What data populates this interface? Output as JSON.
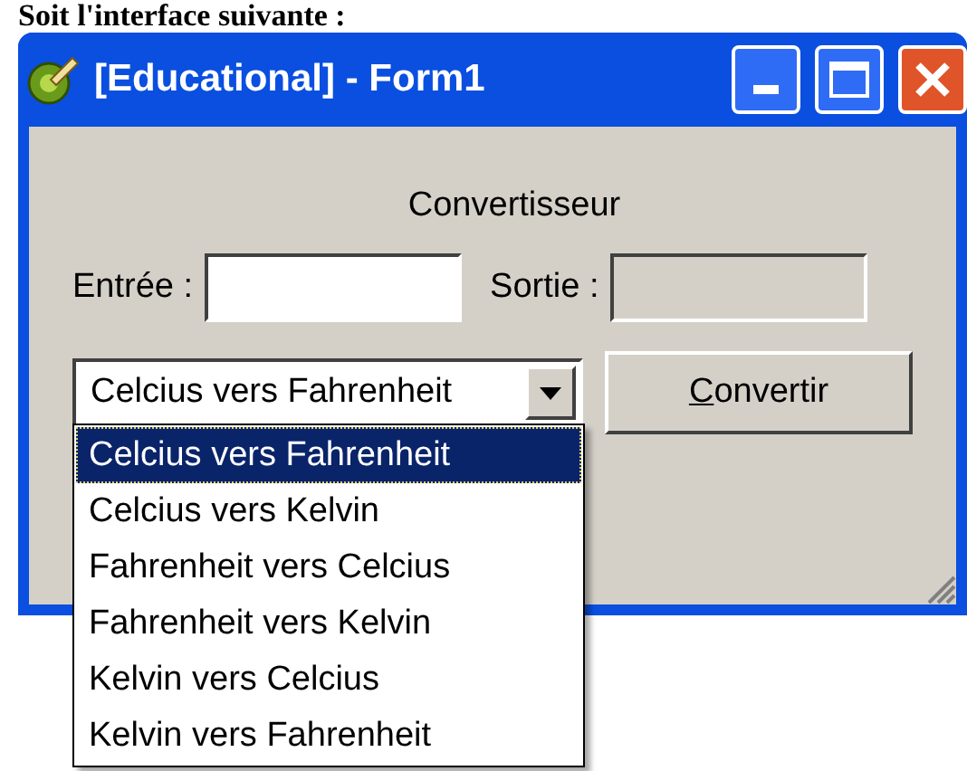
{
  "document": {
    "heading": "Soit l'interface suivante :"
  },
  "window": {
    "title": "[Educational] - Form1",
    "active": true
  },
  "form": {
    "caption": "Convertisseur",
    "input": {
      "label": "Entrée :",
      "disabled": false
    },
    "output": {
      "label": "Sortie :",
      "disabled": true
    },
    "combo": {
      "value": "Celcius vers Fahrenheit",
      "expanded": true,
      "options": [
        {
          "label": "Celcius vers Fahrenheit",
          "selected": true
        },
        {
          "label": "Celcius vers Kelvin",
          "selected": false
        },
        {
          "label": "Fahrenheit vers Celcius",
          "selected": false
        },
        {
          "label": "Fahrenheit vers Kelvin",
          "selected": false
        },
        {
          "label": "Kelvin vers Celcius",
          "selected": false
        },
        {
          "label": "Kelvin vers Fahrenheit",
          "selected": false
        }
      ]
    },
    "button": {
      "label": "Convertir"
    }
  }
}
